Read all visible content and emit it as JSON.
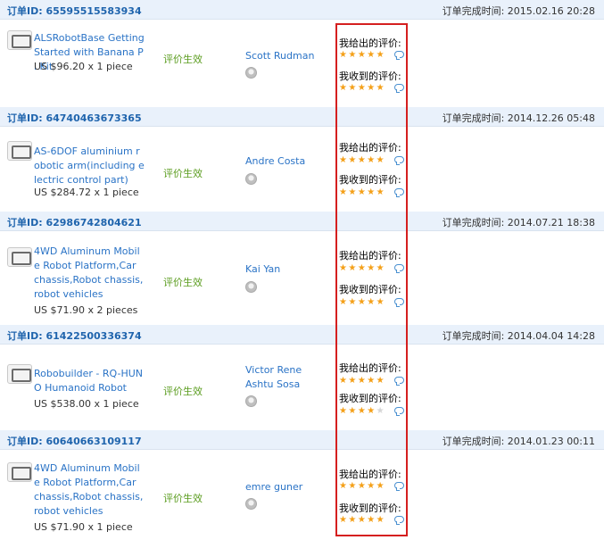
{
  "labels": {
    "order_prefix": "订单ID: ",
    "date_prefix": "订单完成时间: ",
    "given": "我给出的评价:",
    "received": "我收到的评价:",
    "status": "评价生效"
  },
  "colors": {
    "highlight": "#d51f1f",
    "link": "#2a73c6",
    "status": "#5a9c1e",
    "star": "#f4a019"
  },
  "orders": [
    {
      "id_text": "订单ID: 65595515583934",
      "date_text": "订单完成时间: 2015.02.16 20:28",
      "product": "ALSRobotBase Getting Started with Banana Pi Kit",
      "price": "US $96.20 x 1 piece",
      "status": "评价生效",
      "buyer": "Scott Rudman",
      "given": "我给出的评价:",
      "received": "我收到的评价:",
      "given_stars": 5,
      "received_stars": 5
    },
    {
      "id_text": "订单ID: 64740463673365",
      "date_text": "订单完成时间: 2014.12.26 05:48",
      "product": "AS-6DOF aluminium robotic arm(including electric control part)",
      "price": "US $284.72 x 1 piece",
      "status": "评价生效",
      "buyer": "Andre Costa",
      "given": "我给出的评价:",
      "received": "我收到的评价:",
      "given_stars": 5,
      "received_stars": 5
    },
    {
      "id_text": "订单ID: 62986742804621",
      "date_text": "订单完成时间: 2014.07.21 18:38",
      "product": "4WD Aluminum Mobile Robot Platform,Car chassis,Robot chassis,robot vehicles",
      "price": "US $71.90 x 2 pieces",
      "status": "评价生效",
      "buyer": "Kai Yan",
      "given": "我给出的评价:",
      "received": "我收到的评价:",
      "given_stars": 5,
      "received_stars": 5
    },
    {
      "id_text": "订单ID: 61422500336374",
      "date_text": "订单完成时间: 2014.04.04 14:28",
      "product": "Robobuilder - RQ-HUNO Humanoid Robot",
      "price": "US $538.00 x 1 piece",
      "status": "评价生效",
      "buyer": "Victor Rene Ashtu Sosa",
      "given": "我给出的评价:",
      "received": "我收到的评价:",
      "given_stars": 5,
      "received_stars": 4
    },
    {
      "id_text": "订单ID: 60640663109117",
      "date_text": "订单完成时间: 2014.01.23 00:11",
      "product": "4WD Aluminum Mobile Robot Platform,Car chassis,Robot chassis,robot vehicles",
      "price": "US $71.90 x 1 piece",
      "status": "评价生效",
      "buyer": "emre guner",
      "given": "我给出的评价:",
      "received": "我收到的评价:",
      "given_stars": 5,
      "received_stars": 5
    }
  ]
}
